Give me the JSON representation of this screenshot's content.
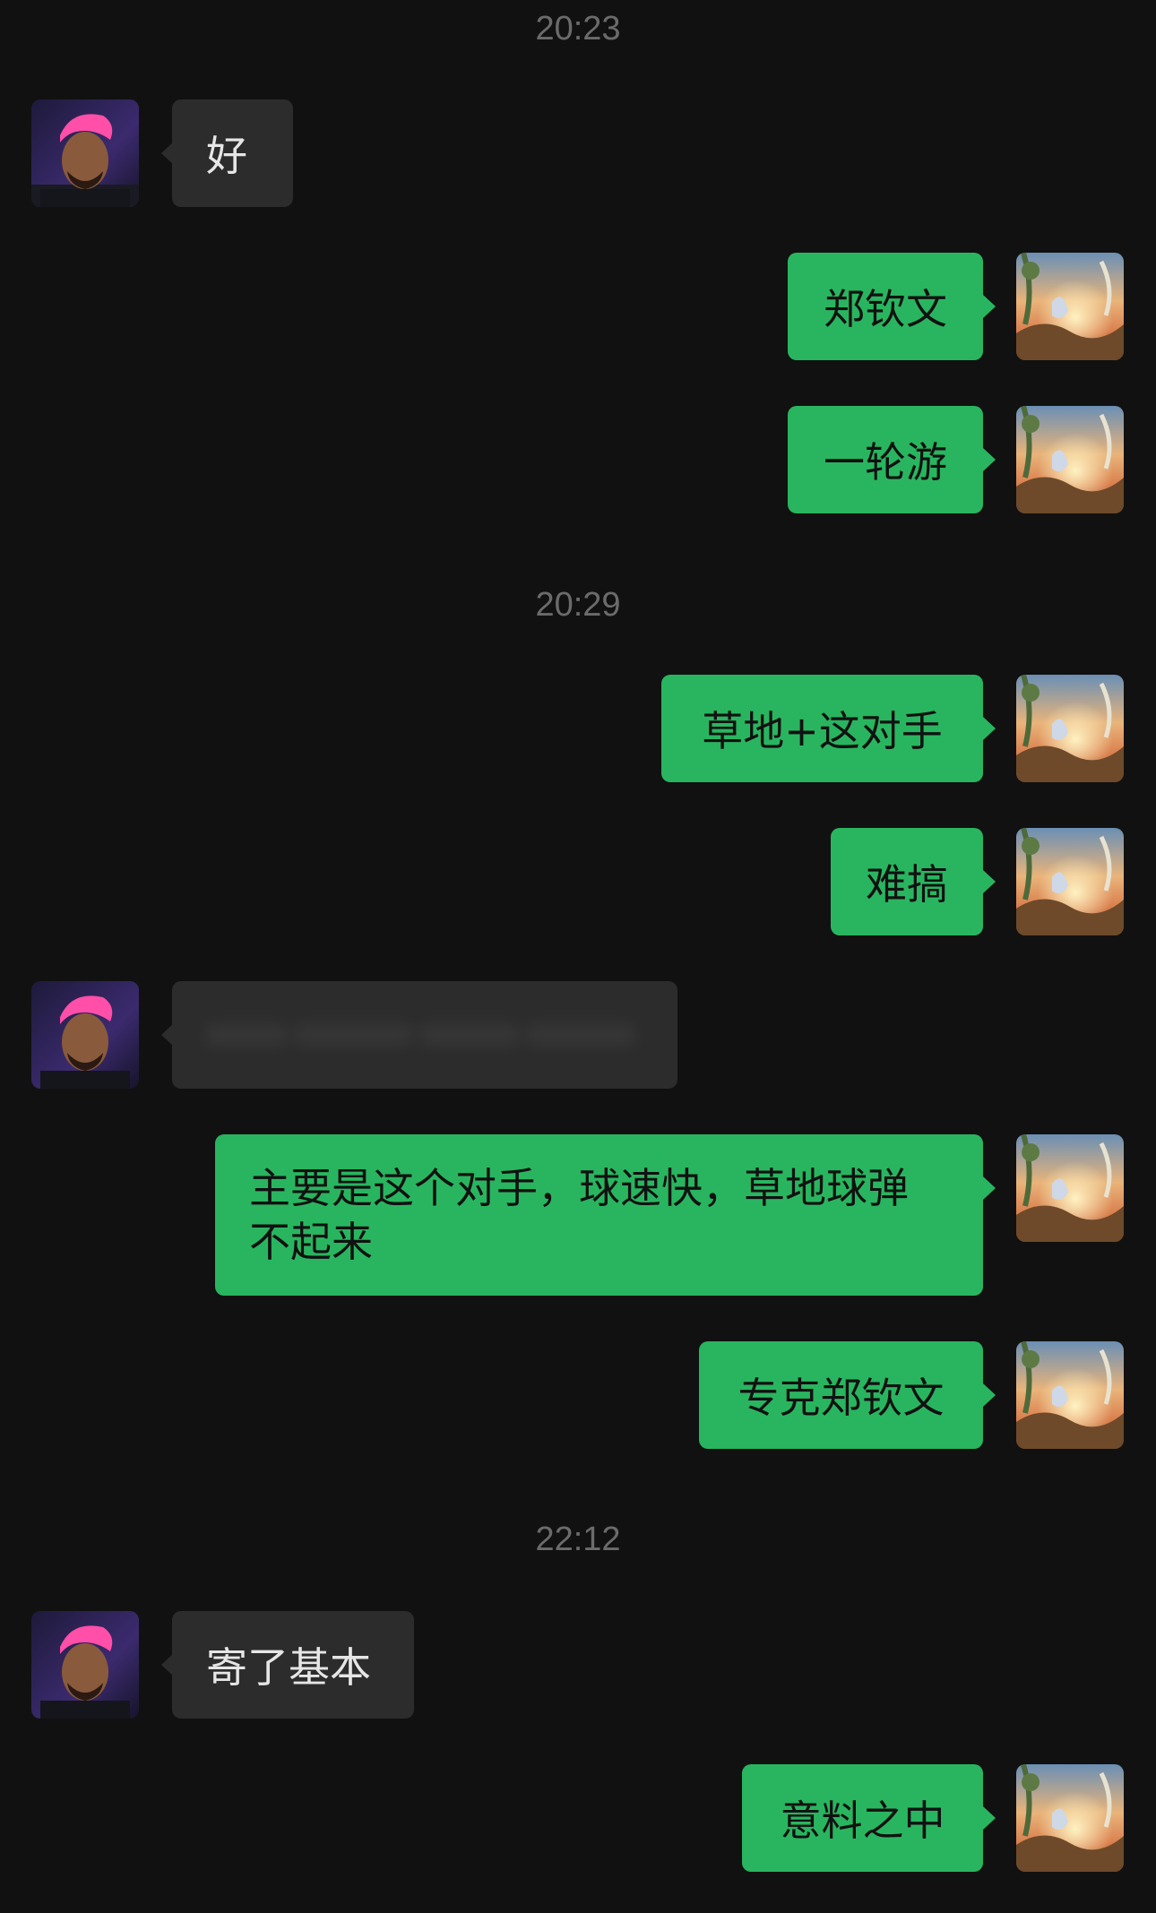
{
  "timestamps": [
    "20:23",
    "20:29",
    "22:12"
  ],
  "messages": {
    "m1": "好",
    "m2": "郑钦文",
    "m3": "一轮游",
    "m4": "草地+这对手",
    "m5": "难搞",
    "m6": "",
    "m7": "主要是这个对手，球速快，草地球弹不起来",
    "m8": "专克郑钦文",
    "m9": "寄了基本",
    "m10": "意料之中"
  },
  "colors": {
    "background": "#111111",
    "incoming_bubble": "#2c2c2c",
    "outgoing_bubble": "#29b55f",
    "timestamp": "#6b6b6b"
  },
  "icons": {
    "contact_avatar": "contact-avatar-pink-hair-man",
    "self_avatar": "self-avatar-painted-landscape"
  }
}
